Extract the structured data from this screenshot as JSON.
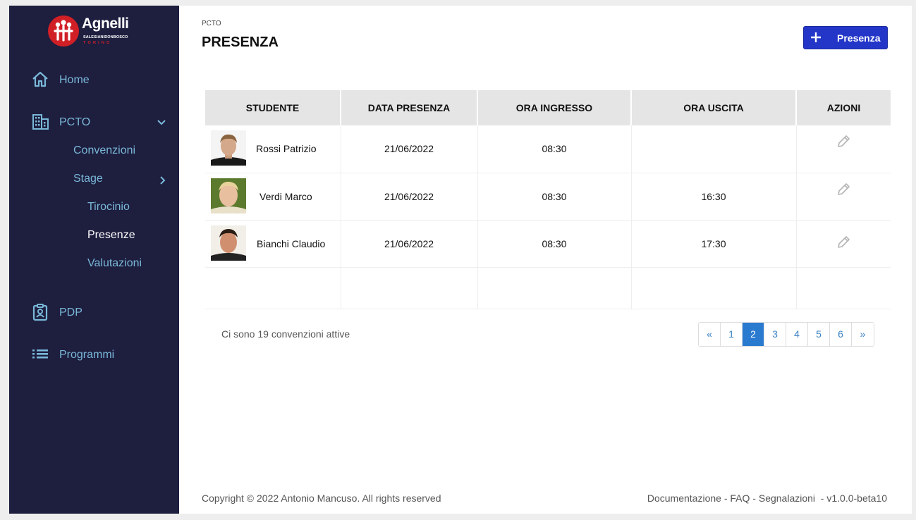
{
  "brand": {
    "name": "Agnelli",
    "subtitle": "SALESIANIDONBOSCO",
    "city": "TORINO",
    "accent": "#d11f26"
  },
  "sidebar": {
    "bg": "#1e1e3f",
    "items": [
      {
        "label": "Home",
        "icon": "home-icon"
      },
      {
        "label": "PCTO",
        "icon": "building-icon",
        "expanded": true
      },
      {
        "label": "PDP",
        "icon": "badge-icon"
      },
      {
        "label": "Programmi",
        "icon": "list-icon"
      }
    ],
    "pcto_sub": [
      {
        "label": "Convenzioni"
      },
      {
        "label": "Stage"
      }
    ],
    "stage_sub": [
      {
        "label": "Tirocinio"
      },
      {
        "label": "Presenze",
        "active": true
      },
      {
        "label": "Valutazioni"
      }
    ]
  },
  "header": {
    "breadcrumb": "PCTO",
    "title": "PRESENZA",
    "add_label": "Presenza"
  },
  "table": {
    "columns": [
      "STUDENTE",
      "DATA PRESENZA",
      "ORA INGRESSO",
      "ORA USCITA",
      "AZIONI"
    ],
    "rows": [
      {
        "student": "Rossi Patrizio",
        "date": "21/06/2022",
        "in": "08:30",
        "out": ""
      },
      {
        "student": "Verdi Marco",
        "date": "21/06/2022",
        "in": "08:30",
        "out": "16:30"
      },
      {
        "student": "Bianchi Claudio",
        "date": "21/06/2022",
        "in": "08:30",
        "out": "17:30"
      }
    ]
  },
  "summary": "Ci sono 19 convenzioni attive",
  "pagination": {
    "prev": "«",
    "pages": [
      "1",
      "2",
      "3",
      "4",
      "5",
      "6"
    ],
    "current": "2",
    "next": "»"
  },
  "footer": {
    "copyright": "Copyright © 2022 Antonio Mancuso. All rights reserved",
    "links": [
      "Documentazione",
      "FAQ",
      "Segnalazioni"
    ],
    "version": "v1.0.0-beta10"
  }
}
